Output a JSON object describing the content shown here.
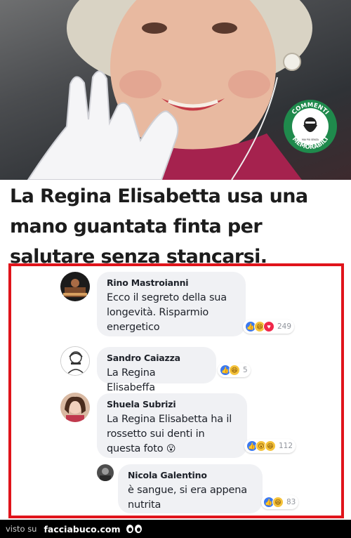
{
  "headline": "La Regina Elisabetta usa una mano guantata finta per salutare senza stancarsi.",
  "badge": {
    "top_text": "COMMENTI",
    "bottom_text": "MEMORABILI",
    "center_text": "MAI PIÙ SENZA",
    "colors": {
      "ring": "#1f8a4c",
      "inner": "#ffffff"
    }
  },
  "comments": [
    {
      "author": "Rino Mastroianni",
      "text": "Ecco il segreto della sua longevità. Risparmio energetico",
      "reactions": [
        "like",
        "haha",
        "love"
      ],
      "count": "249"
    },
    {
      "author": "Sandro Caiazza",
      "text": "La Regina Elisabeffa",
      "reactions": [
        "like",
        "haha"
      ],
      "count": "5"
    },
    {
      "author": "Shuela Subrizi",
      "text": "La Regina Elisabetta ha il rossetto sui denti in questa foto",
      "emoji": "😮",
      "reactions": [
        "like",
        "wow",
        "haha"
      ],
      "count": "112"
    },
    {
      "author": "Nicola Galentino",
      "text": "è sangue, si era appena nutrita",
      "reactions": [
        "like",
        "haha"
      ],
      "count": "83"
    }
  ],
  "footer": {
    "prefix": "visto su",
    "site": "facciabuco.com"
  },
  "colors": {
    "frame": "#e0141b",
    "bubble": "#f0f1f4",
    "like": "#3b79f0",
    "love": "#f0284a",
    "haha": "#f5c33b",
    "footer": "#000000"
  }
}
